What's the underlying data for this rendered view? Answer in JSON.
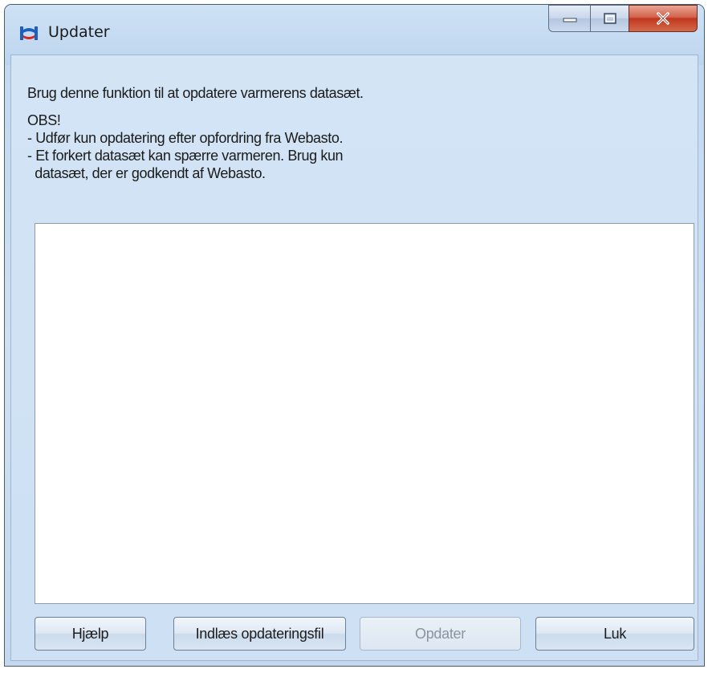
{
  "window": {
    "title": "Updater",
    "controls": {
      "minimize": "minimize-icon",
      "maximize": "maximize-icon",
      "close": "close-icon"
    }
  },
  "message": {
    "line1": "Brug denne funktion til at opdatere varmerens datasæt.",
    "line2": "OBS!",
    "line3": "- Udfør kun opdatering efter opfordring fra Webasto.",
    "line4": "- Et forkert datasæt kan spærre varmeren. Brug kun",
    "line5": "  datasæt, der er godkendt af Webasto."
  },
  "output": {
    "content": ""
  },
  "buttons": {
    "help": "Hjælp",
    "load": "Indlæs opdateringsfil",
    "update": "Opdater",
    "close": "Luk"
  },
  "colors": {
    "accent_red": "#d8261c",
    "accent_blue": "#1d5fbf",
    "disabled_text": "#8a949f"
  }
}
